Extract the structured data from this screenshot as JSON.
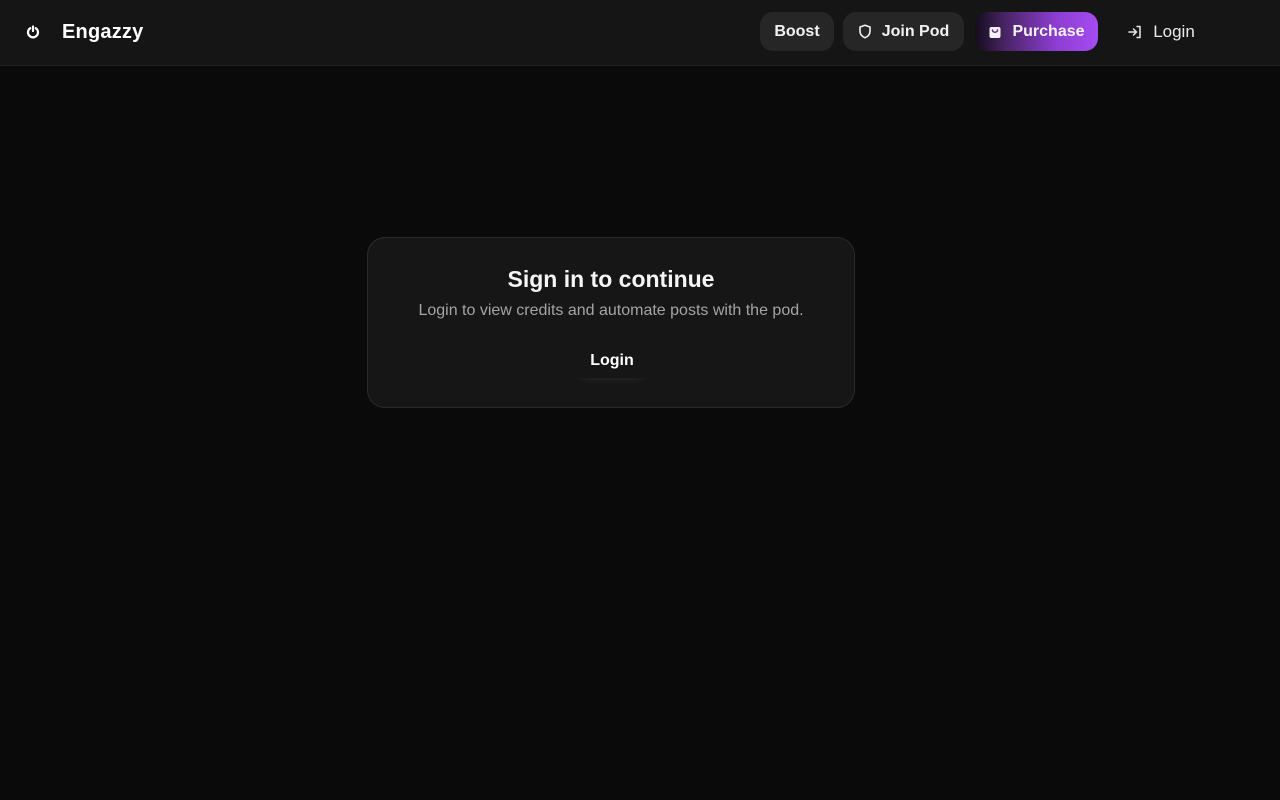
{
  "brand": {
    "name": "Engazzy",
    "icon": "flame-icon"
  },
  "nav": {
    "boost_label": "Boost",
    "join_pod_label": "Join Pod",
    "join_pod_icon": "shield-icon",
    "purchase_label": "Purchase",
    "purchase_icon": "shopping-bag-icon",
    "login_label": "Login",
    "login_icon": "login-arrow-icon"
  },
  "card": {
    "title": "Sign in to continue",
    "subtitle": "Login to view credits and automate posts with the pod.",
    "login_label": "Login"
  },
  "colors": {
    "background": "#0a0a0a",
    "topbar": "#151515",
    "nav_button": "#262626",
    "purchase_gradient_end": "#a64bf2",
    "card": "#161616"
  }
}
